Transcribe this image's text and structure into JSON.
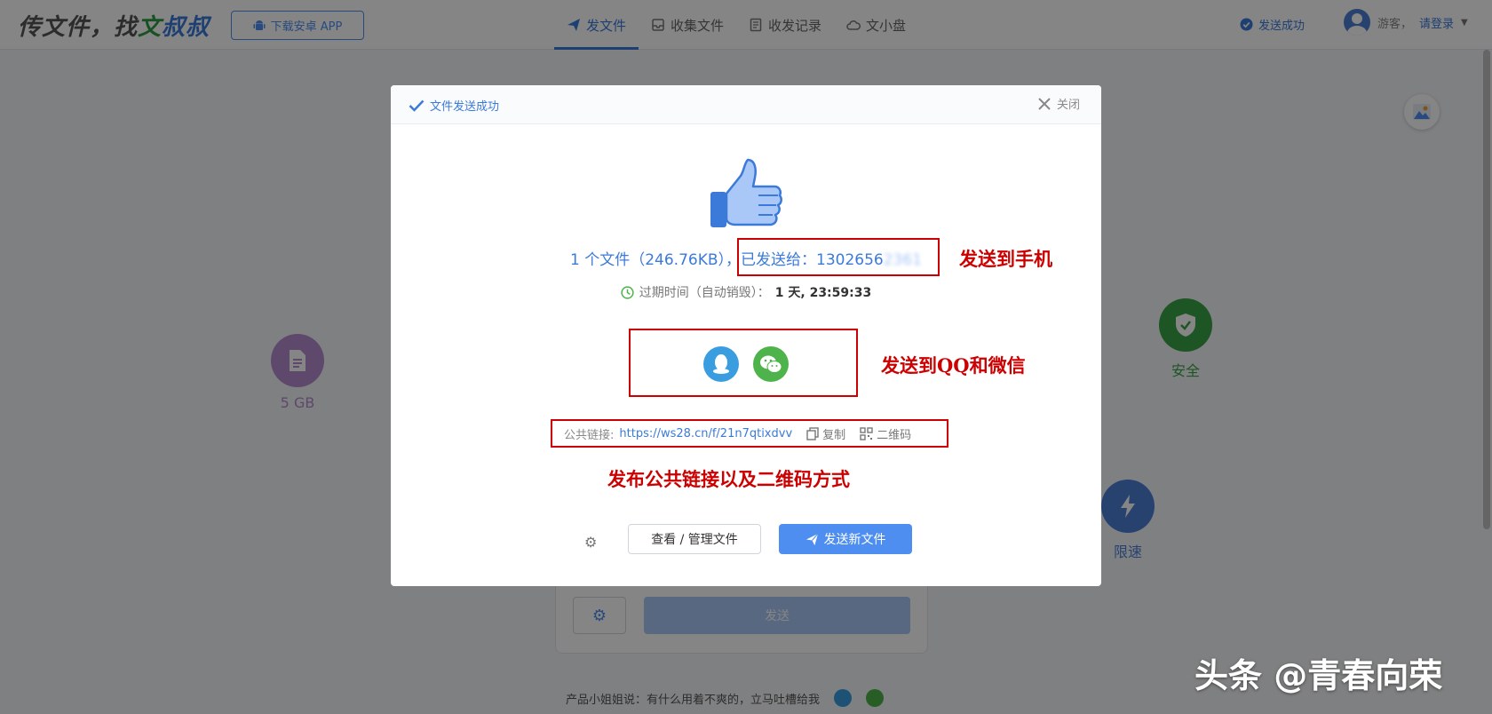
{
  "header": {
    "logo_pre": "传文件，找",
    "logo_hl1": "文",
    "logo_hl2": "叔叔",
    "app_button": "下载安卓 APP",
    "nav": [
      {
        "label": "发文件",
        "icon": "paper-plane-icon",
        "active": true
      },
      {
        "label": "收集文件",
        "icon": "inbox-icon",
        "active": false
      },
      {
        "label": "收发记录",
        "icon": "list-icon",
        "active": false
      },
      {
        "label": "文小盘",
        "icon": "cloud-icon",
        "active": false
      }
    ],
    "status": "发送成功",
    "user_guest": "游客，",
    "user_login": "请登录"
  },
  "background": {
    "feature_left": "5 GB",
    "feature_right_top": "安全",
    "feature_right_bottom": "限速",
    "send_button": "发送",
    "footer_tip": "产品小姐姐说：有什么用着不爽的，立马吐槽给我"
  },
  "dialog": {
    "title": "文件发送成功",
    "close": "关闭",
    "file_info": "1 个文件（246.76KB），",
    "sent_to_label": "已发送给：",
    "phone_visible": "1302656",
    "phone_blurred": "2361",
    "expire_label": "过期时间（自动销毁）：",
    "expire_value": "1 天, 23:59:33",
    "public_link_label": "公共链接:",
    "public_link_url": "https://ws28.cn/f/21n7qtixdvv",
    "copy": "复制",
    "qrcode": "二维码",
    "manage_button": "查看 / 管理文件",
    "send_new_button": "发送新文件"
  },
  "annotations": {
    "phone": "发送到手机",
    "qq_wechat": "发送到QQ和微信",
    "public_link": "发布公共链接以及二维码方式"
  },
  "watermark": "头条 @青春向荣",
  "colors": {
    "accent": "#3b7ad8",
    "primary_button": "#4d8ef0",
    "annotation_red": "#cc0000",
    "qq_blue": "#3a9de0",
    "wechat_green": "#4db34a",
    "feature_purple": "#b48ad0",
    "feature_green": "#3aa346"
  }
}
